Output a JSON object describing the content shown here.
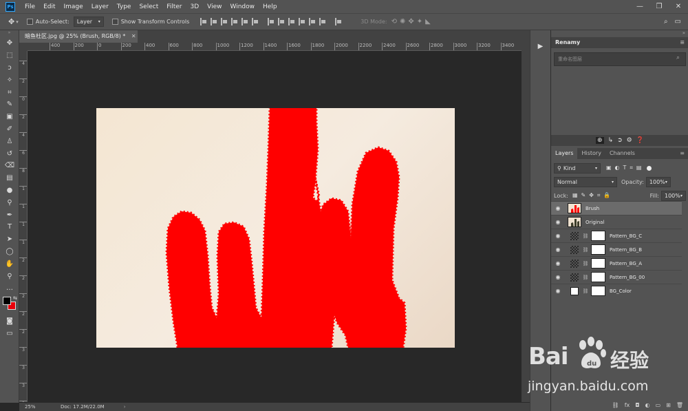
{
  "menubar": {
    "app_icon": "Ps",
    "items": [
      "File",
      "Edit",
      "Image",
      "Layer",
      "Type",
      "Select",
      "Filter",
      "3D",
      "View",
      "Window",
      "Help"
    ]
  },
  "options": {
    "auto_select_label": "Auto-Select:",
    "auto_select_value": "Layer",
    "show_transform_label": "Show Transform Controls",
    "mode_3d_label": "3D Mode:"
  },
  "document": {
    "tab_title": "暗鱼杜区.jpg @ 25% (Brush, RGB/8) *",
    "zoom": "25%",
    "doc_info": "Doc: 17.2M/22.0M"
  },
  "rulers": {
    "h_ticks": [
      "400",
      "200",
      "0",
      "200",
      "400",
      "600",
      "800",
      "1000",
      "1200",
      "1400",
      "1600",
      "1800",
      "2000",
      "2200",
      "2400",
      "2600",
      "2800",
      "3000",
      "3200",
      "3400"
    ],
    "v_ticks": [
      "4",
      "2",
      "0",
      "2",
      "4",
      "6",
      "8",
      "1",
      "1",
      "1",
      "1",
      "2",
      "2",
      "2",
      "2",
      "2",
      "3",
      "3",
      "3",
      "3"
    ]
  },
  "renamy": {
    "title": "Renamy",
    "search_placeholder": "重命名图层"
  },
  "layers_panel": {
    "tabs": [
      "Layers",
      "History",
      "Channels"
    ],
    "kind_label": "Kind",
    "blend_mode": "Normal",
    "opacity_label": "Opacity:",
    "opacity_value": "100%",
    "lock_label": "Lock:",
    "fill_label": "Fill:",
    "fill_value": "100%",
    "layers": [
      {
        "name": "Brush",
        "type": "brush",
        "selected": true
      },
      {
        "name": "Original",
        "type": "photo",
        "selected": false
      },
      {
        "name": "Pattern_BG_C",
        "type": "pattern",
        "selected": false
      },
      {
        "name": "Pattern_BG_B",
        "type": "pattern",
        "selected": false
      },
      {
        "name": "Pattern_BG_A",
        "type": "pattern",
        "selected": false
      },
      {
        "name": "Pattern_BG_00",
        "type": "pattern",
        "selected": false
      },
      {
        "name": "BG_Color",
        "type": "color",
        "selected": false
      }
    ]
  },
  "watermark": {
    "brand": "Bai",
    "brand_suffix": "du",
    "cn_text": "经验",
    "url": "jingyan.baidu.com"
  },
  "colors": {
    "foreground": "#000000",
    "background": "#e8000a",
    "brush_red": "#ff0000"
  }
}
